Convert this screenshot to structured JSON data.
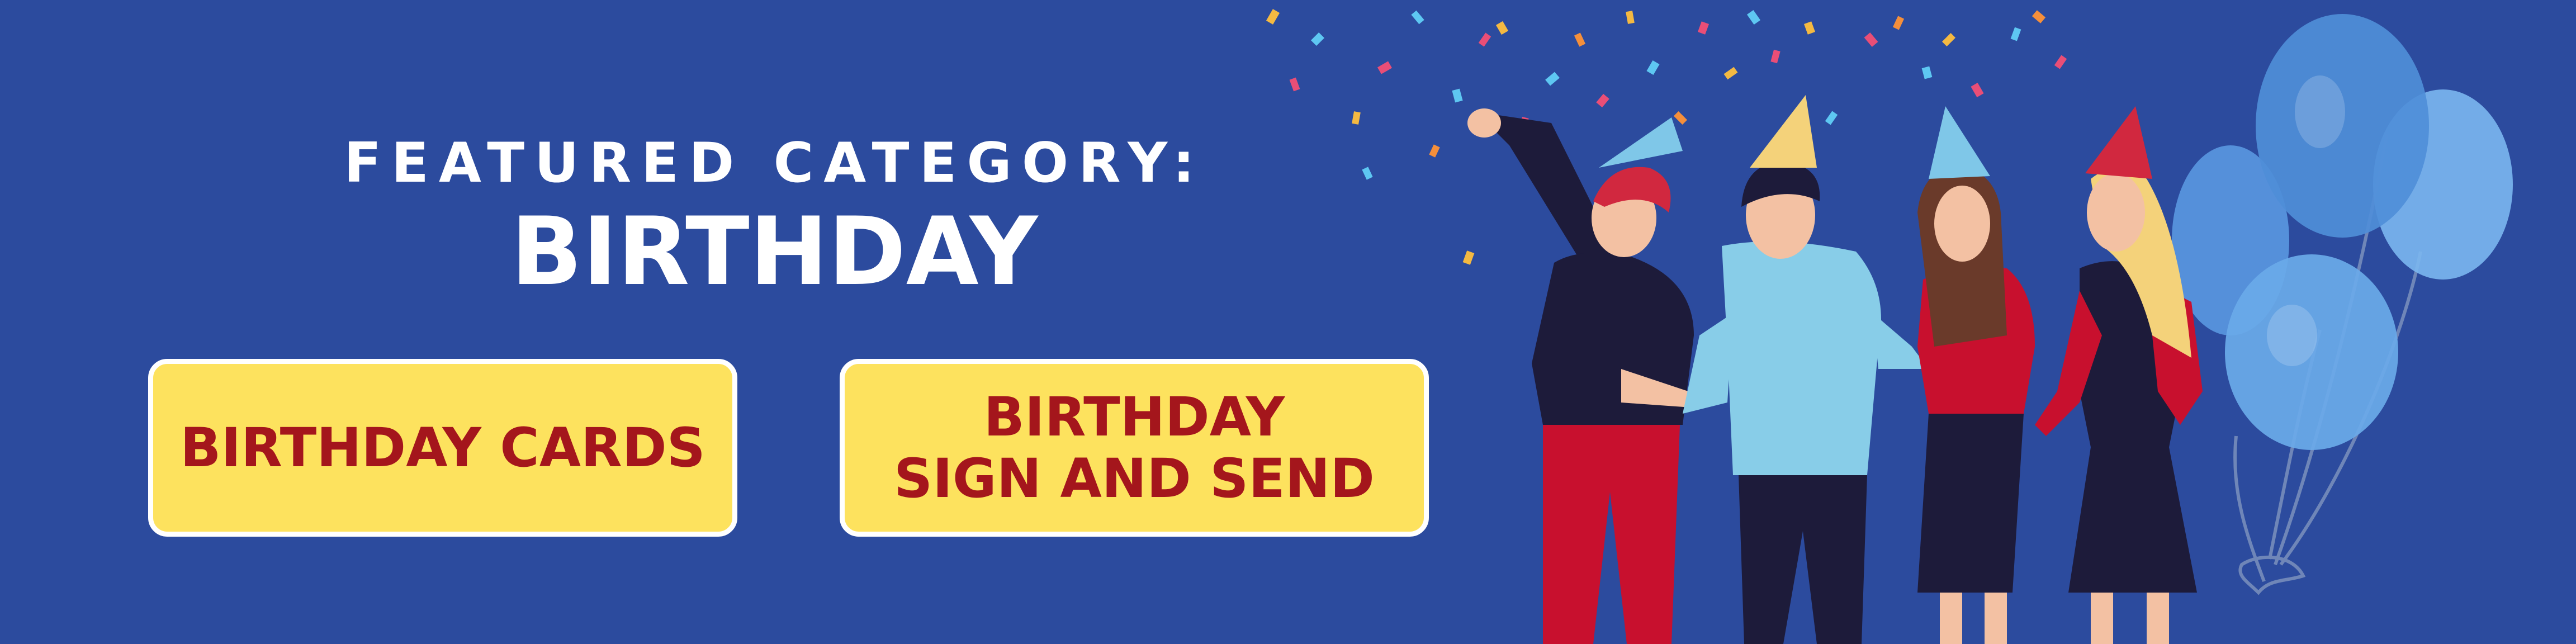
{
  "banner": {
    "eyebrow": "FEATURED CATEGORY:",
    "headline": "BIRTHDAY",
    "buttons": [
      {
        "label": "BIRTHDAY CARDS"
      },
      {
        "label": "BIRTHDAY\nSIGN AND SEND"
      }
    ]
  },
  "colors": {
    "background": "#2c4b9e",
    "button_fill": "#fde25e",
    "button_text": "#a4161c",
    "button_border": "#ffffff",
    "heading_text": "#ffffff"
  },
  "illustration": {
    "icons": [
      "party-people-illustration",
      "confetti-icon",
      "party-hat-icon",
      "balloon-icon"
    ]
  }
}
